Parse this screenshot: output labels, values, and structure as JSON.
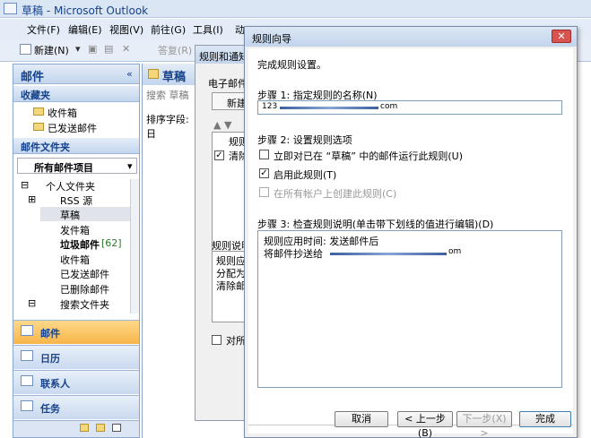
{
  "window": {
    "title": "草稿 - Microsoft Outlook"
  },
  "menubar": [
    "文件(F)",
    "编辑(E)",
    "视图(V)",
    "前往(G)",
    "工具(I)",
    "动"
  ],
  "toolbar": {
    "new_label": "新建(N)",
    "reply_label": "答复(R)"
  },
  "nav": {
    "header": "邮件",
    "collapse_glyph": "«",
    "favorites_header": "收藏夹",
    "favorites": [
      "收件箱",
      "已发送邮件"
    ],
    "mail_folders_header": "邮件文件夹",
    "all_items": "所有邮件项目",
    "tree": {
      "personal": "个人文件夹",
      "rss": "RSS 源",
      "drafts": "草稿",
      "outbox": "发件箱",
      "junk": "垃圾邮件",
      "junk_count": "[62]",
      "inbox": "收件箱",
      "sent": "已发送邮件",
      "deleted": "已删除邮件",
      "search": "搜索文件夹"
    },
    "buttons": {
      "mail": "邮件",
      "calendar": "日历",
      "contacts": "联系人",
      "tasks": "任务"
    }
  },
  "mid": {
    "title": "草稿",
    "search": "搜索 草稿",
    "sort": "排序字段: 日"
  },
  "rules_window": {
    "title": "规则和通知",
    "tab": "电子邮件",
    "new": "新建",
    "col": "规则",
    "row": "清除",
    "desc_label": "规则说明",
    "desc_lines": [
      "规则应",
      "分配为",
      "清除邮"
    ],
    "check": "对所有"
  },
  "wizard": {
    "title": "规则向导",
    "heading": "完成规则设置。",
    "step1": "步骤 1: 指定规则的名称(N)",
    "name_value_prefix": "123",
    "name_value_suffix": "com",
    "step2": "步骤 2: 设置规则选项",
    "opt1": "立即对已在 “草稿” 中的邮件运行此规则(U)",
    "opt2": "启用此规则(T)",
    "opt3": "在所有帐户上创建此规则(C)",
    "step3": "步骤 3: 检查规则说明(单击带下划线的值进行编辑)(D)",
    "desc_line1": "规则应用时间: 发送邮件后",
    "desc_line2": "将邮件抄送给",
    "desc_suffix": "om",
    "buttons": {
      "cancel": "取消",
      "back": "< 上一步(B)",
      "next": "下一步(X) >",
      "finish": "完成"
    }
  }
}
